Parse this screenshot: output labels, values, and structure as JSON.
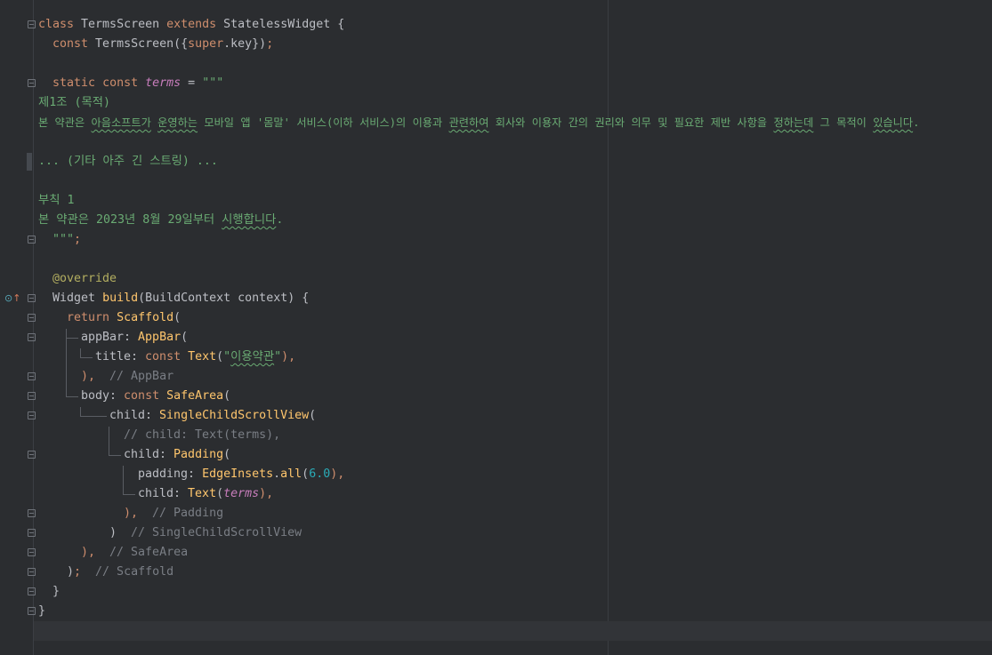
{
  "editor": {
    "language": "dart",
    "lines": {
      "l1": [
        "class",
        " TermsScreen ",
        "extends",
        " StatelessWidget {"
      ],
      "l2": [
        "const",
        " TermsScreen({",
        "super",
        ".key})",
        ";"
      ],
      "l4": [
        "static",
        " ",
        "const",
        " ",
        "terms",
        " = ",
        "\"\"\""
      ],
      "l5": "제1조 (목적)",
      "l6": {
        "p1": "본 약관은 ",
        "s1": "아음소프트가",
        "p2": " ",
        "s2": "운영하는",
        "p3": " 모바일 앱 '몸말' 서비스(이하 서비스)의 이용과 ",
        "s3": "관련하여",
        "p4": " 회사와 이용자 간의 권리와 의무 및 필요한 제반 사항을 ",
        "s4": "정하는데",
        "p5": " 그 목적이 ",
        "s5": "있습니다",
        "p6": "."
      },
      "l8": "... (기타 아주 긴 스트링) ...",
      "l10": "부칙 1",
      "l11": {
        "p1": "본 약관은 2023년 8월 29일부터 ",
        "s1": "시행합니다",
        "p2": "."
      },
      "l12": [
        "\"\"\"",
        ";"
      ],
      "l14": "@override",
      "l15": [
        "Widget ",
        "build",
        "(BuildContext context) {"
      ],
      "l16": [
        "return",
        " ",
        "Scaffold",
        "("
      ],
      "l17": [
        "appBar: ",
        "AppBar",
        "("
      ],
      "l18": [
        "title: ",
        "const",
        " ",
        "Text",
        "(",
        "\"",
        "이용약관",
        "\"",
        "),"
      ],
      "l19": [
        "),",
        "  // AppBar"
      ],
      "l20": [
        "body: ",
        "const",
        " ",
        "SafeArea",
        "("
      ],
      "l21": [
        "child: ",
        "SingleChildScrollView",
        "("
      ],
      "l22": "// child: Text(terms),",
      "l23": [
        "child: ",
        "Padding",
        "("
      ],
      "l24": [
        "padding: ",
        "EdgeInsets",
        ".",
        "all",
        "(",
        "6.0",
        "),"
      ],
      "l25": [
        "child: ",
        "Text",
        "(",
        "terms",
        "),"
      ],
      "l26": [
        "),",
        "  // Padding"
      ],
      "l27": [
        ")",
        "  // SingleChildScrollView"
      ],
      "l28": [
        "),",
        "  // SafeArea"
      ],
      "l29": [
        ")",
        ";",
        "  // Scaffold"
      ],
      "l30": "}",
      "l31": "}"
    }
  },
  "colors": {
    "background": "#2b2d30",
    "keyword": "#cf8e6d",
    "string": "#6aab73",
    "function": "#ffc66d",
    "comment": "#7a7e85",
    "field": "#c77dbb",
    "number": "#2aacb8",
    "annotation": "#b3ae60"
  },
  "icons": {
    "override": "override-method-icon",
    "fold": "fold-marker-icon"
  }
}
